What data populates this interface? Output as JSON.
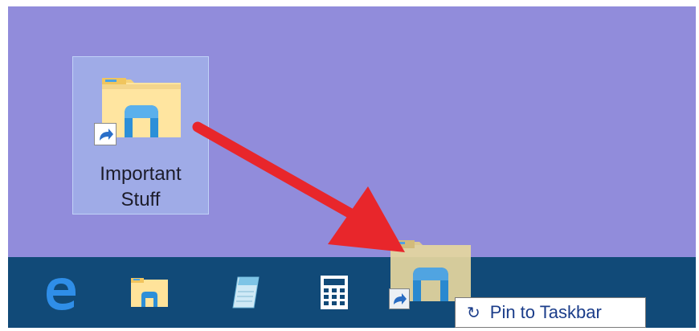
{
  "desktop": {
    "background_color": "#918cdb",
    "icon": {
      "label_line1": "Important",
      "label_line2": "Stuff",
      "icon_name": "folder-icon",
      "badge_name": "shortcut-arrow-icon"
    }
  },
  "taskbar": {
    "background_color": "#114a78",
    "items": [
      {
        "icon_name": "edge-icon"
      },
      {
        "icon_name": "file-explorer-icon"
      },
      {
        "icon_name": "notepad-icon"
      },
      {
        "icon_name": "calculator-icon"
      }
    ]
  },
  "drag": {
    "icon_name": "folder-icon",
    "tooltip_glyph": "↻",
    "tooltip_text": "Pin to Taskbar"
  },
  "annotation": {
    "arrow_color": "#e8262b"
  }
}
